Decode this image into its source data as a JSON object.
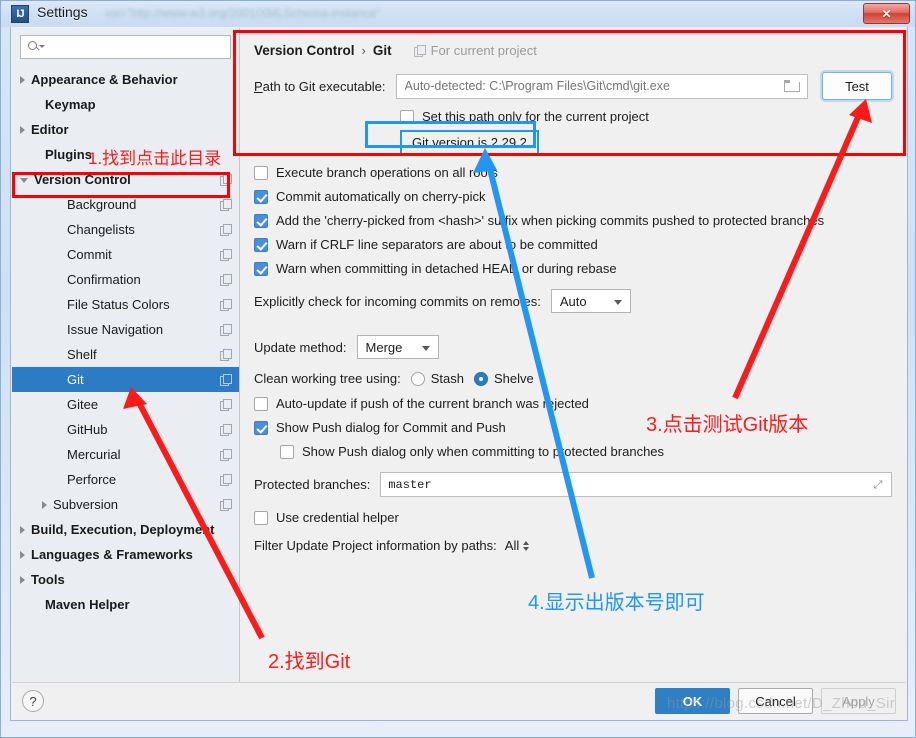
{
  "window": {
    "title": "Settings",
    "app_icon": "intellij-idea-icon",
    "close_label": "✕",
    "ghost_title": "xsi=\"http://www.w3.org/2001/XMLSchema-instance\""
  },
  "sidebar": {
    "search": {
      "value": "",
      "placeholder": "",
      "icon": "search-icon"
    },
    "items": [
      {
        "label": "Appearance & Behavior",
        "arrow": "right",
        "bold": true,
        "indent": 8,
        "copy": false,
        "selected": false
      },
      {
        "label": "Keymap",
        "arrow": "none",
        "bold": true,
        "indent": 22,
        "copy": false,
        "selected": false
      },
      {
        "label": "Editor",
        "arrow": "right",
        "bold": true,
        "indent": 8,
        "copy": false,
        "selected": false
      },
      {
        "label": "Plugins",
        "arrow": "none",
        "bold": true,
        "indent": 22,
        "copy": false,
        "selected": false
      },
      {
        "label": "Version Control",
        "arrow": "down",
        "bold": true,
        "indent": 8,
        "copy": true,
        "selected": false
      },
      {
        "label": "Background",
        "arrow": "none",
        "bold": false,
        "indent": 44,
        "copy": true,
        "selected": false
      },
      {
        "label": "Changelists",
        "arrow": "none",
        "bold": false,
        "indent": 44,
        "copy": true,
        "selected": false
      },
      {
        "label": "Commit",
        "arrow": "none",
        "bold": false,
        "indent": 44,
        "copy": true,
        "selected": false
      },
      {
        "label": "Confirmation",
        "arrow": "none",
        "bold": false,
        "indent": 44,
        "copy": true,
        "selected": false
      },
      {
        "label": "File Status Colors",
        "arrow": "none",
        "bold": false,
        "indent": 44,
        "copy": true,
        "selected": false
      },
      {
        "label": "Issue Navigation",
        "arrow": "none",
        "bold": false,
        "indent": 44,
        "copy": true,
        "selected": false
      },
      {
        "label": "Shelf",
        "arrow": "none",
        "bold": false,
        "indent": 44,
        "copy": true,
        "selected": false
      },
      {
        "label": "Git",
        "arrow": "none",
        "bold": false,
        "indent": 44,
        "copy": true,
        "selected": true
      },
      {
        "label": "Gitee",
        "arrow": "none",
        "bold": false,
        "indent": 44,
        "copy": true,
        "selected": false
      },
      {
        "label": "GitHub",
        "arrow": "none",
        "bold": false,
        "indent": 44,
        "copy": true,
        "selected": false
      },
      {
        "label": "Mercurial",
        "arrow": "none",
        "bold": false,
        "indent": 44,
        "copy": true,
        "selected": false
      },
      {
        "label": "Perforce",
        "arrow": "none",
        "bold": false,
        "indent": 44,
        "copy": true,
        "selected": false
      },
      {
        "label": "Subversion",
        "arrow": "right",
        "bold": false,
        "indent": 30,
        "copy": true,
        "selected": false
      },
      {
        "label": "Build, Execution, Deployment",
        "arrow": "right",
        "bold": true,
        "indent": 8,
        "copy": false,
        "selected": false
      },
      {
        "label": "Languages & Frameworks",
        "arrow": "right",
        "bold": true,
        "indent": 8,
        "copy": false,
        "selected": false
      },
      {
        "label": "Tools",
        "arrow": "right",
        "bold": true,
        "indent": 8,
        "copy": false,
        "selected": false
      },
      {
        "label": "Maven Helper",
        "arrow": "none",
        "bold": true,
        "indent": 22,
        "copy": false,
        "selected": false
      }
    ]
  },
  "main": {
    "breadcrumb": {
      "root": "Version Control",
      "separator": "›",
      "leaf": "Git"
    },
    "scope_note": "For current project",
    "path_row": {
      "label_prefix": "P",
      "label_rest": "ath to Git executable:",
      "value": "",
      "placeholder": "Auto-detected: C:\\Program Files\\Git\\cmd\\git.exe",
      "browse_icon": "folder-icon",
      "test_button": "Test"
    },
    "path_only_checkbox": {
      "label": "Set this path only for the current project",
      "checked": false
    },
    "version_chip": "Git version is 2.29.2",
    "checkboxes": [
      {
        "label": "Execute branch operations on all roots",
        "checked": false,
        "indent": 0
      },
      {
        "label": "Commit automatically on cherry-pick",
        "checked": true,
        "indent": 0
      },
      {
        "label": "Add the 'cherry-picked from <hash>' suffix when picking commits pushed to protected branches",
        "checked": true,
        "indent": 0
      },
      {
        "label": "Warn if CRLF line separators are about to be committed",
        "checked": true,
        "indent": 0
      },
      {
        "label": "Warn when committing in detached HEAD or during rebase",
        "checked": true,
        "indent": 0
      }
    ],
    "incoming_row": {
      "label": "Explicitly check for incoming commits on remotes:",
      "value": "Auto"
    },
    "update_method": {
      "label": "Update method:",
      "value": "Merge"
    },
    "clean_tree": {
      "label": "Clean working tree using:",
      "options": [
        {
          "label": "Stash",
          "selected": false
        },
        {
          "label": "Shelve",
          "selected": true
        }
      ]
    },
    "checkboxes2": [
      {
        "label": "Auto-update if push of the current branch was rejected",
        "checked": false,
        "indent": 0
      },
      {
        "label": "Show Push dialog for Commit and Push",
        "checked": true,
        "indent": 0
      },
      {
        "label": "Show Push dialog only when committing to protected branches",
        "checked": false,
        "indent": 26
      }
    ],
    "protected_branches": {
      "label": "Protected branches:",
      "value": "master",
      "expand_icon": "expand-icon"
    },
    "credential_helper": {
      "label": "Use credential helper",
      "checked": false
    },
    "filter_paths": {
      "label": "Filter Update Project information by paths:",
      "value": "All"
    }
  },
  "footer": {
    "help": "?",
    "ok": "OK",
    "cancel": "Cancel",
    "apply": "Apply",
    "watermark": "https://blog.csdn.net/D_Zhou_Sir"
  },
  "annotations": [
    {
      "id": "a1",
      "text": "1.找到点击此目录",
      "color": "red"
    },
    {
      "id": "a2",
      "text": "2.找到Git",
      "color": "red"
    },
    {
      "id": "a3",
      "text": "3.点击测试Git版本",
      "color": "red"
    },
    {
      "id": "a4",
      "text": "4.显示出版本号即可",
      "color": "blue"
    }
  ],
  "colors": {
    "accent_blue": "#2b7cc4",
    "checkbox_blue": "#4a90d9",
    "annotation_red": "#ff1a1a",
    "annotation_blue": "#2196f3",
    "selection_blue": "#2b7cc4"
  }
}
